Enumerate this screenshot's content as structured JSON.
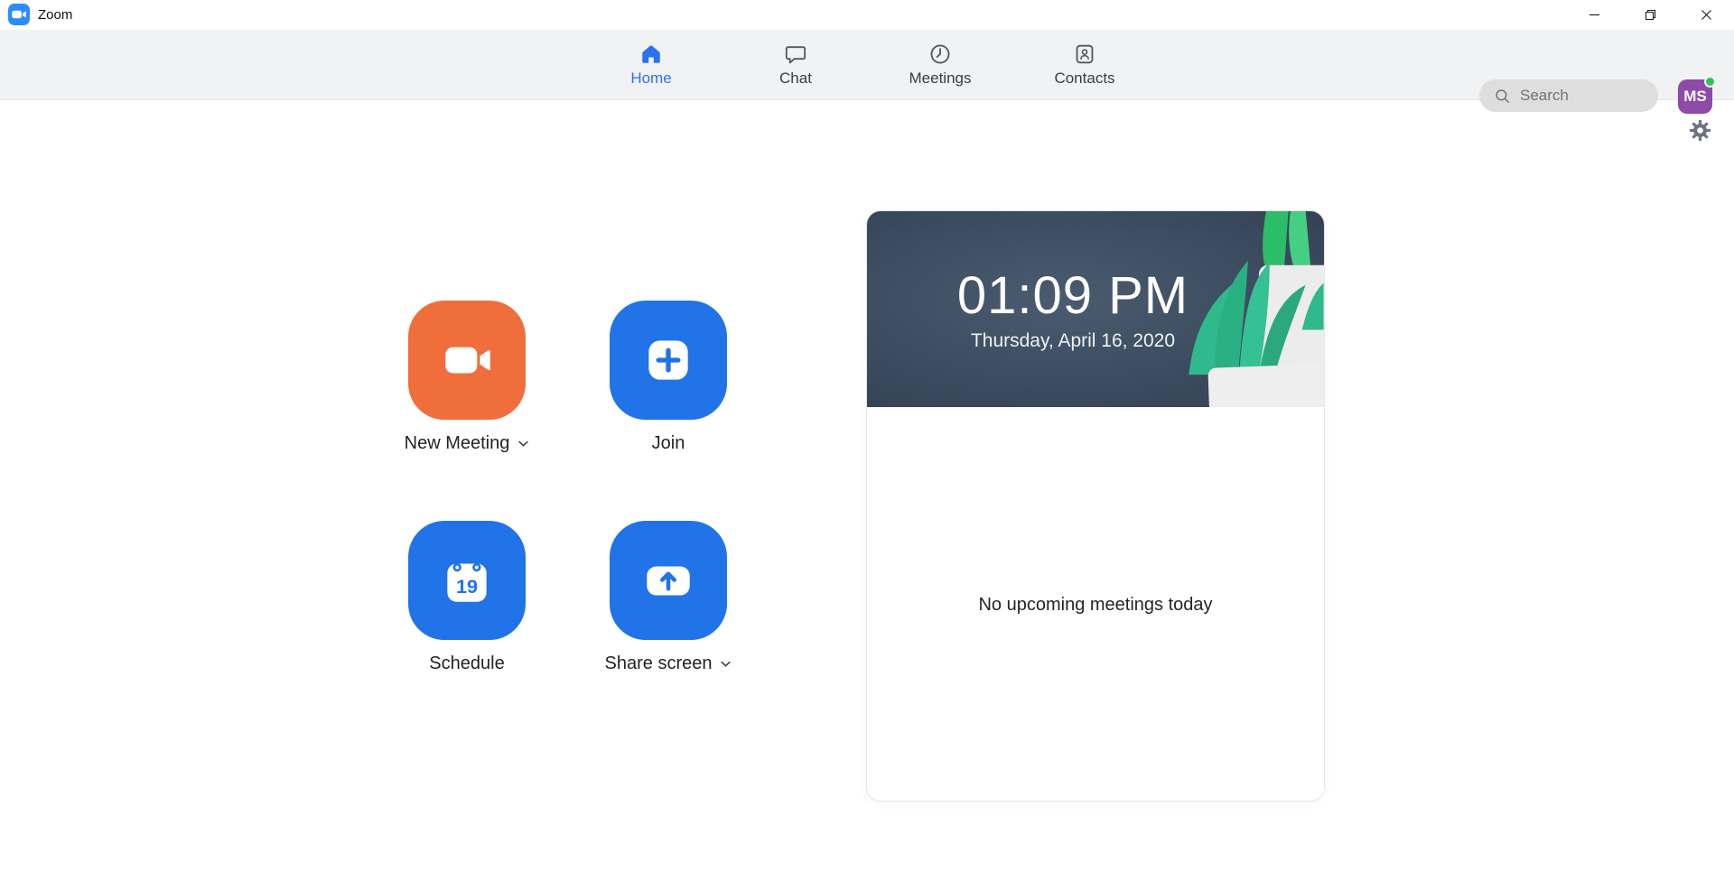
{
  "window": {
    "title": "Zoom",
    "controls": {
      "minimize": "minimize",
      "restore": "restore-down",
      "close": "close"
    }
  },
  "nav": {
    "tabs": [
      {
        "label": "Home",
        "icon": "home-icon",
        "active": true
      },
      {
        "label": "Chat",
        "icon": "chat-bubble-icon",
        "active": false
      },
      {
        "label": "Meetings",
        "icon": "clock-icon",
        "active": false
      },
      {
        "label": "Contacts",
        "icon": "contact-card-icon",
        "active": false
      }
    ],
    "search": {
      "placeholder": "Search"
    },
    "profile": {
      "initials": "MS",
      "status": "online"
    }
  },
  "main": {
    "actions": [
      {
        "label": "New Meeting",
        "icon": "video-camera-icon",
        "has_dropdown": true,
        "color": "#f06e3c"
      },
      {
        "label": "Join",
        "icon": "plus-icon",
        "has_dropdown": false,
        "color": "#2173e8"
      },
      {
        "label": "Schedule",
        "icon": "calendar-icon",
        "calendar_day": "19",
        "has_dropdown": false,
        "color": "#2173e8"
      },
      {
        "label": "Share screen",
        "icon": "share-up-arrow-icon",
        "has_dropdown": true,
        "color": "#2173e8"
      }
    ],
    "meeting_card": {
      "time": "01:09 PM",
      "date": "Thursday, April 16, 2020",
      "empty_message": "No upcoming meetings today"
    }
  },
  "colors": {
    "accent_blue": "#2a72f2",
    "button_blue": "#2173e8",
    "button_orange": "#f06e3c",
    "avatar_purple": "#8d4ba7",
    "status_green": "#31c452",
    "banner_slate": "#3a4a5e",
    "navbar_gray": "#f1f2f4"
  }
}
